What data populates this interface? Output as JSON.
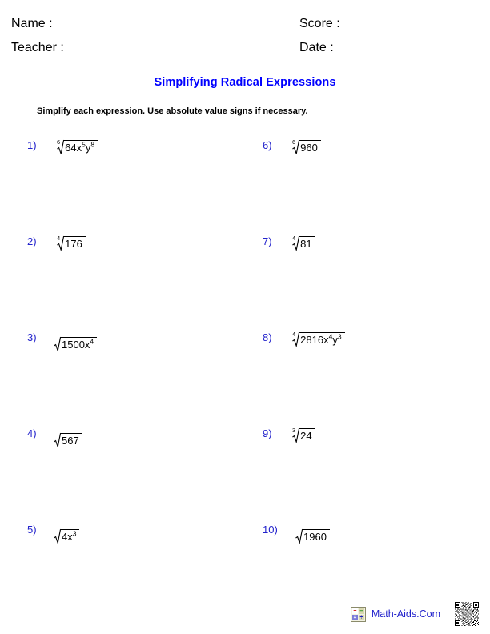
{
  "header": {
    "fields": [
      {
        "label": "Name :",
        "value": "",
        "rule": "long"
      },
      {
        "label": "Score :",
        "value": "",
        "rule": "short"
      },
      {
        "label": "Teacher :",
        "value": "",
        "rule": "long"
      },
      {
        "label": "Date :",
        "value": "",
        "rule": "short"
      }
    ],
    "name_label": "Name :",
    "teacher_label": "Teacher :",
    "score_label": "Score :",
    "date_label": "Date :"
  },
  "title": "Simplifying Radical Expressions",
  "title_color": "#0000FF",
  "instructions": "Simplify each expression. Use absolute value signs if necessary.",
  "number_color": "#2222CC",
  "problems": [
    {
      "number": "1)",
      "index": "6",
      "radicand_html": "64x<sup>5</sup>y<sup>8</sup>",
      "radicand_text": "64x^5y^8",
      "expression": "sixth root of 64x^5y^8"
    },
    {
      "number": "6)",
      "index": "6",
      "radicand_html": "960",
      "radicand_text": "960",
      "expression": "sixth root of 960"
    },
    {
      "number": "2)",
      "index": "4",
      "radicand_html": "176",
      "radicand_text": "176",
      "expression": "fourth root of 176"
    },
    {
      "number": "7)",
      "index": "4",
      "radicand_html": "81",
      "radicand_text": "81",
      "expression": "fourth root of 81"
    },
    {
      "number": "3)",
      "index": "",
      "radicand_html": "1500x<sup>4</sup>",
      "radicand_text": "1500x^4",
      "expression": "square root of 1500x^4"
    },
    {
      "number": "8)",
      "index": "4",
      "radicand_html": "2816x<sup>4</sup>y<sup>3</sup>",
      "radicand_text": "2816x^4y^3",
      "expression": "fourth root of 2816x^4y^3"
    },
    {
      "number": "4)",
      "index": "",
      "radicand_html": "567",
      "radicand_text": "567",
      "expression": "square root of 567"
    },
    {
      "number": "9)",
      "index": "3",
      "radicand_html": "24",
      "radicand_text": "24",
      "expression": "cube root of 24"
    },
    {
      "number": "5)",
      "index": "",
      "radicand_html": "4x<sup>3</sup>",
      "radicand_text": "4x^3",
      "expression": "square root of 4x^3"
    },
    {
      "number": "10)",
      "index": "",
      "radicand_html": "1960",
      "radicand_text": "1960",
      "expression": "square root of 1960"
    }
  ],
  "footer": {
    "brand": "Math-Aids.Com",
    "brand_color": "#2222CC",
    "calculator_keys": [
      "+",
      "–",
      "×",
      "÷"
    ]
  }
}
